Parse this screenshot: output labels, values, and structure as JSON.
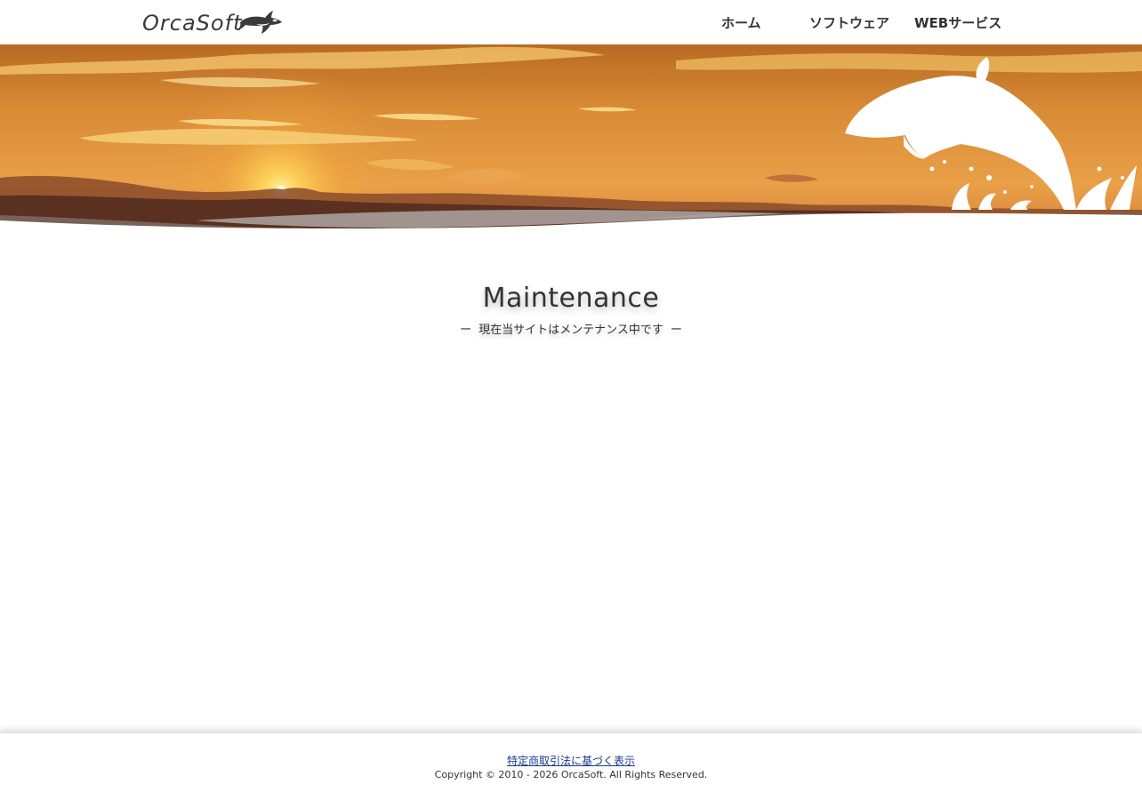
{
  "header": {
    "logo_text": "OrcaSoft",
    "nav": [
      {
        "label": "ホーム"
      },
      {
        "label": "ソフトウェア"
      },
      {
        "label": "WEBサービス"
      }
    ]
  },
  "main": {
    "title": "Maintenance",
    "subtitle_dash_left": "ー",
    "subtitle": "現在当サイトはメンテナンス中です",
    "subtitle_dash_right": "ー"
  },
  "footer": {
    "link_label": "特定商取引法に基づく表示",
    "copyright": "Copyright © 2010 - 2026 OrcaSoft. All Rights Reserved."
  },
  "colors": {
    "text": "#333333",
    "link": "#1a3a8a",
    "sky_top": "#c9782a",
    "sky_mid": "#e9a24a",
    "sunset": "#f2b24c"
  }
}
